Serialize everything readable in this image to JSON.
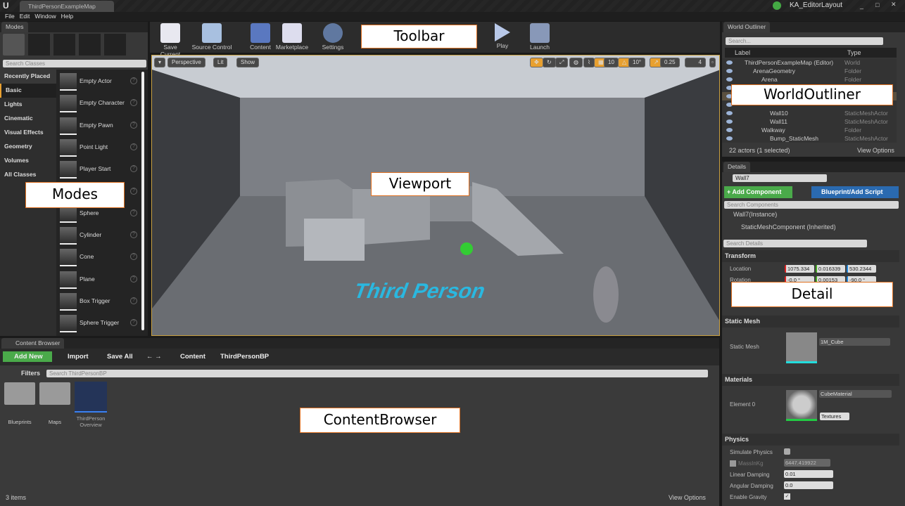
{
  "window": {
    "doc_tab": "ThirdPersonExampleMap",
    "layout_name": "KA_EditorLayout"
  },
  "menu": [
    "File",
    "Edit",
    "Window",
    "Help"
  ],
  "modes": {
    "tab": "Modes",
    "search_placeholder": "Search Classes",
    "categories": [
      "Recently Placed",
      "Basic",
      "Lights",
      "Cinematic",
      "Visual Effects",
      "Geometry",
      "Volumes",
      "All Classes"
    ],
    "selected_category": "Basic",
    "items": [
      "Empty Actor",
      "Empty Character",
      "Empty Pawn",
      "Point Light",
      "Player Start",
      "",
      "Sphere",
      "Cylinder",
      "Cone",
      "Plane",
      "Box Trigger",
      "Sphere Trigger"
    ]
  },
  "toolbar": {
    "buttons": [
      "Save Current",
      "Source Control",
      "Content",
      "Marketplace",
      "Settings",
      "Play",
      "Launch"
    ]
  },
  "viewport": {
    "view_mode": "Perspective",
    "lighting": "Lit",
    "show": "Show",
    "grid_snap": "10",
    "rotation_snap": "10°",
    "scale_snap": "0.25",
    "camera_speed": "4",
    "floor_text": "Third Person"
  },
  "outliner": {
    "tab": "World Outliner",
    "search_placeholder": "Search...",
    "col_label": "Label",
    "col_type": "Type",
    "rows": [
      {
        "label": "ThirdPersonExampleMap (Editor)",
        "type": "World"
      },
      {
        "label": "ArenaGeometry",
        "type": "Folder"
      },
      {
        "label": "Arena",
        "type": "Folder"
      },
      {
        "label": "",
        "type": ""
      },
      {
        "label": "",
        "type": ""
      },
      {
        "label": "",
        "type": ""
      },
      {
        "label": "Wall10",
        "type": "StaticMeshActor"
      },
      {
        "label": "Wall11",
        "type": "StaticMeshActor"
      },
      {
        "label": "Walkway",
        "type": "Folder"
      },
      {
        "label": "Bump_StaticMesh",
        "type": "StaticMeshActor"
      }
    ],
    "status": "22 actors (1 selected)",
    "view_options": "View Options"
  },
  "details": {
    "tab": "Details",
    "name": "Wall7",
    "add_component": "+ Add Component",
    "blueprint": "Blueprint/Add Script",
    "search_components": "Search Components",
    "instance": "Wall7(Instance)",
    "component": "StaticMeshComponent (Inherited)",
    "search_details": "Search Details",
    "transform": {
      "title": "Transform",
      "location_label": "Location",
      "location": [
        "1075.334",
        "0.016339",
        "530.2344"
      ],
      "rotation_label": "Rotation",
      "rotation": [
        "-0.0 °",
        "0.00153",
        "-90.0 °"
      ]
    },
    "static_mesh": {
      "title": "Static Mesh",
      "label": "Static Mesh",
      "value": "1M_Cube"
    },
    "materials": {
      "title": "Materials",
      "label": "Element 0",
      "value": "CubeMaterial",
      "textures": "Textures"
    },
    "physics": {
      "title": "Physics",
      "simulate": "Simulate Physics",
      "simulate_checked": false,
      "mass_label": "MassInKg",
      "mass": "6447.419922",
      "linear_label": "Linear Damping",
      "linear": "0.01",
      "angular_label": "Angular Damping",
      "angular": "0.0",
      "gravity_label": "Enable Gravity",
      "gravity_checked": true
    }
  },
  "content_browser": {
    "tab": "Content Browser",
    "add_new": "Add New",
    "import": "Import",
    "save_all": "Save All",
    "path": [
      "Content",
      "ThirdPersonBP"
    ],
    "filters": "Filters",
    "search_placeholder": "Search ThirdPersonBP",
    "assets": [
      "Blueprints",
      "Maps",
      "ThirdPerson Overview"
    ],
    "status": "3 items",
    "view_options": "View Options"
  },
  "overlays": {
    "toolbar": "Toolbar",
    "modes": "Modes",
    "viewport": "Viewport",
    "outliner": "WorldOutliner",
    "details": "Detail",
    "content": "ContentBrowser"
  },
  "colors": {
    "accent_orange": "#e8a030",
    "add_green": "#4aaa4a",
    "blueprint_blue": "#2a6ab0"
  }
}
